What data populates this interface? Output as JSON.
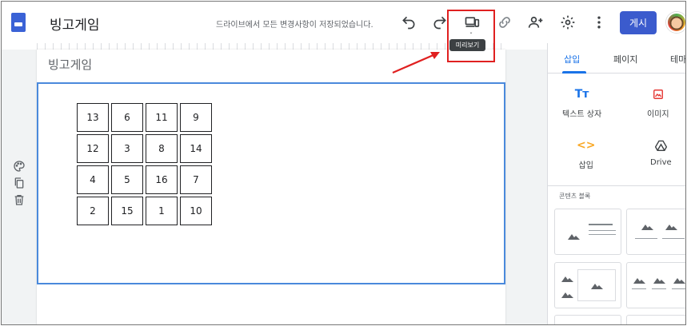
{
  "header": {
    "title": "빙고게임",
    "save_status": "드라이브에서 모든 변경사항이 저장되었습니다.",
    "publish_label": "게시",
    "preview_tooltip": "미리보기",
    "icons": [
      "undo-icon",
      "redo-icon",
      "preview-device-icon",
      "link-icon",
      "add-person-icon",
      "gear-icon",
      "more-vert-icon"
    ]
  },
  "page": {
    "title": "빙고게임",
    "bingo": [
      [
        "13",
        "6",
        "11",
        "9"
      ],
      [
        "12",
        "3",
        "8",
        "14"
      ],
      [
        "4",
        "5",
        "16",
        "7"
      ],
      [
        "2",
        "15",
        "1",
        "10"
      ]
    ]
  },
  "panel": {
    "tabs": [
      "삽입",
      "페이지",
      "테마"
    ],
    "active_tab": "삽입",
    "tools": {
      "text_box": "텍스트 상자",
      "image": "이미지",
      "embed": "삽입",
      "drive": "Drive"
    },
    "content_blocks_label": "콘텐츠 블록"
  },
  "colors": {
    "accent": "#1a73e8",
    "publish": "#3b5bcd",
    "annotation_red": "#e02020",
    "section_border": "#4a89dc"
  }
}
